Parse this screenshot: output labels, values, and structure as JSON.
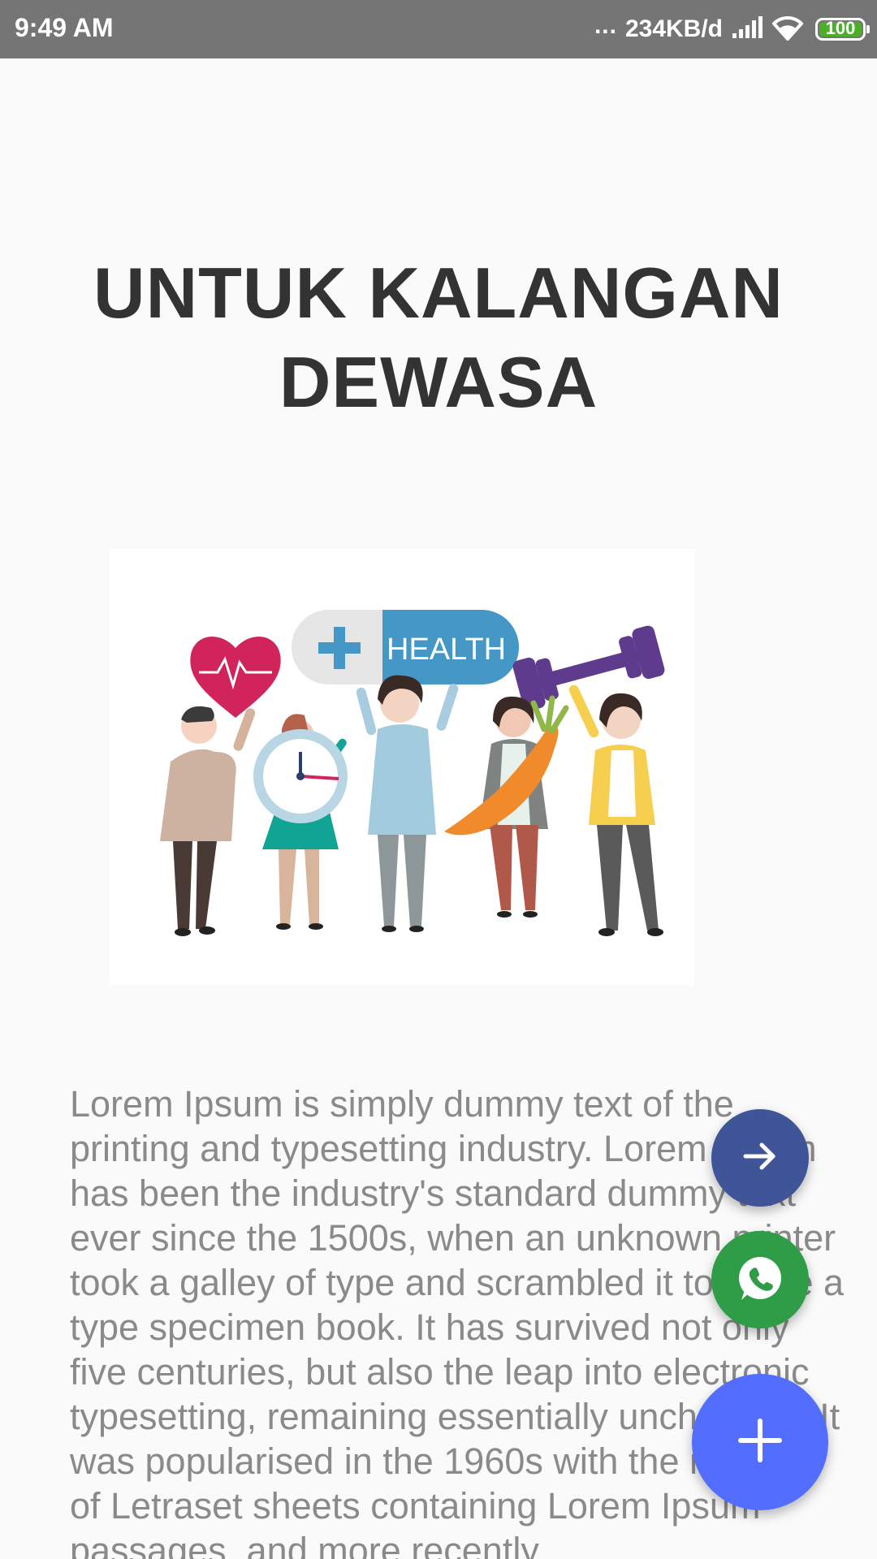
{
  "status_bar": {
    "time": "9:49 AM",
    "dots": "...",
    "network_speed": "234KB/d",
    "battery_level": "100",
    "battery_color": "#4caf2a",
    "icons": [
      "signal-icon",
      "wifi-icon",
      "battery-icon"
    ]
  },
  "page": {
    "title": "UNTUK KALANGAN DEWASA",
    "illustration": {
      "banner_text": "HEALTH"
    },
    "body": "Lorem Ipsum is simply dummy text of the printing and typesetting industry. Lorem Ipsum has been the industry's standard dummy text ever since the 1500s, when an unknown printer took a galley of type and scrambled it to make a type specimen book. It has survived not only five centuries, but also the leap into electronic typesetting, remaining essentially unchanged. It was popularised in the 1960s with the release of Letraset sheets containing Lorem Ipsum passages, and more recently"
  },
  "fabs": {
    "next": {
      "icon": "arrow-right-icon",
      "color": "#3f5597"
    },
    "whatsapp": {
      "icon": "whatsapp-icon",
      "color": "#2f9c47"
    },
    "add": {
      "icon": "plus-icon",
      "color": "#536dfe"
    }
  }
}
